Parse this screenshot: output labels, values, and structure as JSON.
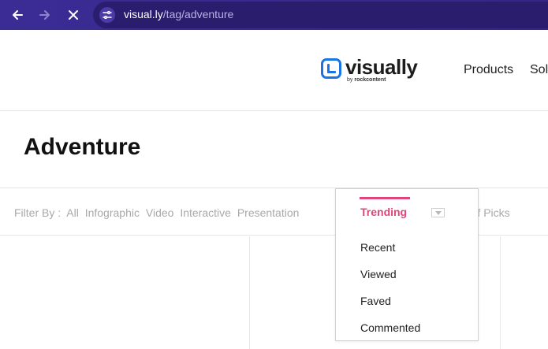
{
  "browser": {
    "url_host": "visual.ly",
    "url_path": "/tag/adventure"
  },
  "header": {
    "logo_word": "visually",
    "logo_sub_prefix": "by",
    "logo_sub_brand": "rockcontent",
    "nav": [
      "Products",
      "Sol"
    ]
  },
  "page": {
    "title": "Adventure"
  },
  "filter": {
    "label": "Filter By :",
    "types": [
      "All",
      "Infographic",
      "Video",
      "Interactive",
      "Presentation"
    ],
    "staff_picks_partial": "aff Picks"
  },
  "sort_dropdown": {
    "selected": "Trending",
    "options": [
      "Recent",
      "Viewed",
      "Faved",
      "Commented"
    ],
    "accent_color": "#e0457b"
  },
  "colors": {
    "browser_bar": "#3b2c95",
    "logo_blue": "#1b74e4"
  }
}
